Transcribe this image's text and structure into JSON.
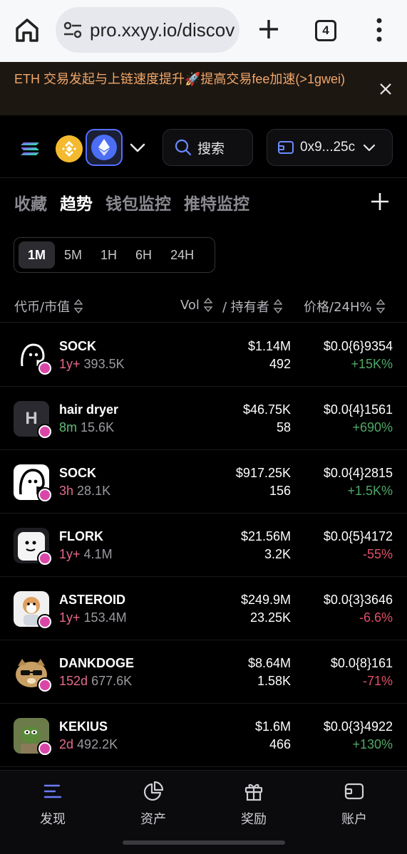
{
  "browser": {
    "url": "pro.xxyy.io/discov",
    "tab_count": "4"
  },
  "banner": {
    "text": "ETH 交易发起与上链速度提升🚀提高交易fee加速(>1gwei)"
  },
  "toolbar": {
    "chains": [
      "solana-icon",
      "bnb-icon",
      "ethereum-icon"
    ],
    "selected_chain": "ethereum",
    "search_label": "搜索",
    "wallet_address": "0x9...25c"
  },
  "tabs": [
    {
      "label": "收藏",
      "active": false
    },
    {
      "label": "趋势",
      "active": true
    },
    {
      "label": "钱包监控",
      "active": false
    },
    {
      "label": "推特监控",
      "active": false
    }
  ],
  "time_filters": [
    {
      "label": "1M",
      "active": true
    },
    {
      "label": "5M",
      "active": false
    },
    {
      "label": "1H",
      "active": false
    },
    {
      "label": "6H",
      "active": false
    },
    {
      "label": "24H",
      "active": false
    }
  ],
  "table": {
    "headers": {
      "token": "代币/市值",
      "vol": "Vol",
      "holders": "/ 持有者",
      "price": "价格/24H%"
    },
    "rows": [
      {
        "name": "SOCK",
        "age": "1y+",
        "age_color": "pink",
        "mcap": "393.5K",
        "vol": "$1.14M",
        "holders": "492",
        "price": "$0.0{6}9354",
        "change": "+15K%",
        "direction": "up",
        "avatar": "sock-avatar"
      },
      {
        "name": "hair dryer",
        "age": "8m",
        "age_color": "green",
        "mcap": "15.6K",
        "vol": "$46.75K",
        "holders": "58",
        "price": "$0.0{4}1561",
        "change": "+690%",
        "direction": "up",
        "avatar": "letter-h-avatar",
        "avatar_letter": "H"
      },
      {
        "name": "SOCK",
        "age": "3h",
        "age_color": "pink",
        "mcap": "28.1K",
        "vol": "$917.25K",
        "holders": "156",
        "price": "$0.0{4}2815",
        "change": "+1.5K%",
        "direction": "up",
        "avatar": "sock-avatar"
      },
      {
        "name": "FLORK",
        "age": "1y+",
        "age_color": "pink",
        "mcap": "4.1M",
        "vol": "$21.56M",
        "holders": "3.2K",
        "price": "$0.0{5}4172",
        "change": "-55%",
        "direction": "down",
        "avatar": "flork-avatar"
      },
      {
        "name": "ASTEROID",
        "age": "1y+",
        "age_color": "pink",
        "mcap": "153.4M",
        "vol": "$249.9M",
        "holders": "23.25K",
        "price": "$0.0{3}3646",
        "change": "-6.6%",
        "direction": "down",
        "avatar": "shiba-astronaut-avatar"
      },
      {
        "name": "DANKDOGE",
        "age": "152d",
        "age_color": "pink",
        "mcap": "677.6K",
        "vol": "$8.64M",
        "holders": "1.58K",
        "price": "$0.0{8}161",
        "change": "-71%",
        "direction": "down",
        "avatar": "doge-sunglasses-avatar"
      },
      {
        "name": "KEKIUS",
        "age": "2d",
        "age_color": "pink",
        "mcap": "492.2K",
        "vol": "$1.6M",
        "holders": "466",
        "price": "$0.0{3}4922",
        "change": "+130%",
        "direction": "up",
        "avatar": "pepe-knight-avatar"
      }
    ]
  },
  "bottom_nav": [
    {
      "label": "发现",
      "icon": "discover-icon",
      "active": true
    },
    {
      "label": "资产",
      "icon": "pie-chart-icon",
      "active": false
    },
    {
      "label": "奖励",
      "icon": "gift-icon",
      "active": false
    },
    {
      "label": "账户",
      "icon": "wallet-icon",
      "active": false
    }
  ],
  "colors": {
    "up": "#4fa866",
    "down": "#e0506a",
    "banner_text": "#f0a76a",
    "accent": "#5470ff"
  }
}
